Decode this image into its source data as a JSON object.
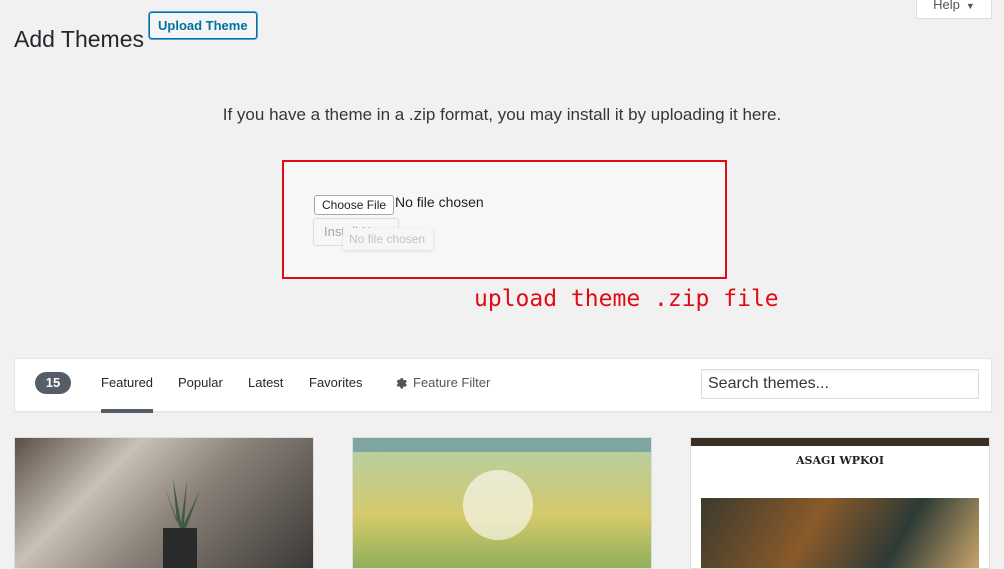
{
  "header": {
    "title": "Add Themes",
    "upload_button": "Upload Theme",
    "help": "Help"
  },
  "upload": {
    "intro": "If you have a theme in a .zip format, you may install it by uploading it here.",
    "choose_file": "Choose File",
    "no_file": "No file chosen",
    "install_now": "Install Now",
    "ghost_tooltip": "No file chosen"
  },
  "annotation": {
    "text": "upload theme .zip file",
    "color": "#e00b16"
  },
  "filter": {
    "count": "15",
    "tabs": [
      "Featured",
      "Popular",
      "Latest",
      "Favorites"
    ],
    "active_tab": "Featured",
    "feature_filter": "Feature Filter",
    "search_placeholder": "Search themes..."
  },
  "themes": [
    {
      "name": "theme-plant-photo"
    },
    {
      "name": "theme-field"
    },
    {
      "name": "theme-asagi-wpkoi",
      "title": "ASAGI WPKOI"
    }
  ]
}
